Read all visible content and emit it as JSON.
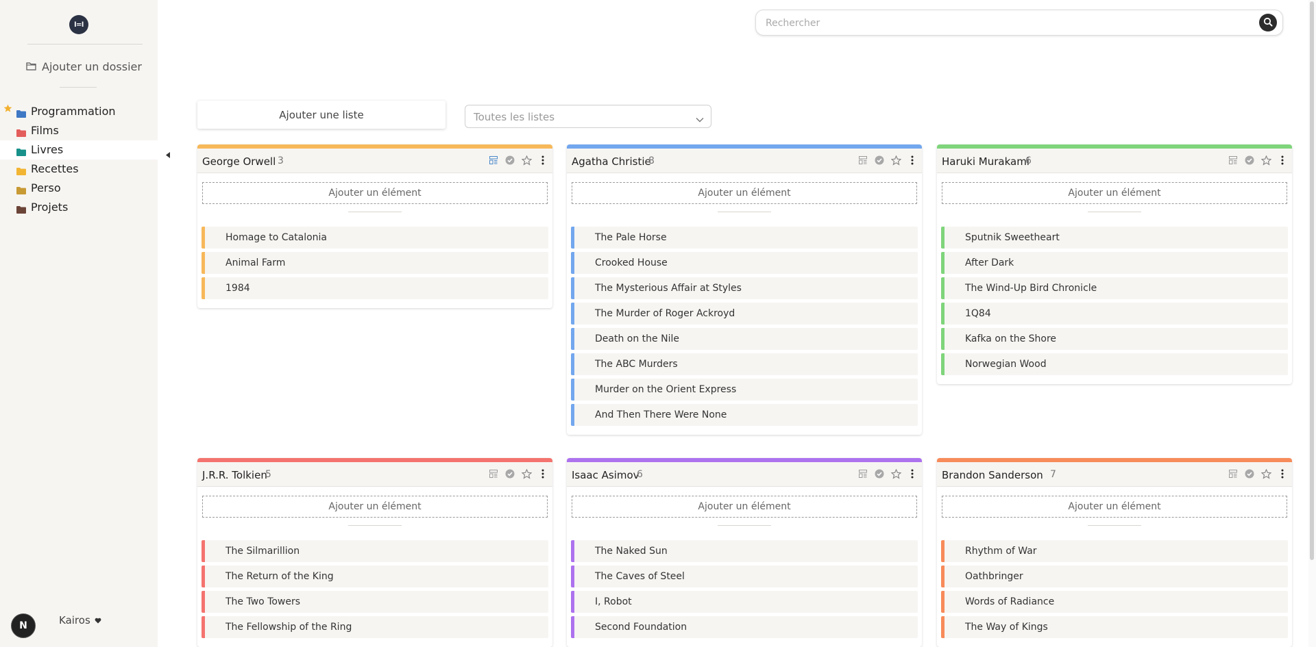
{
  "app": {
    "logo_text": "l=l"
  },
  "sidebar": {
    "add_folder_label": "Ajouter un dossier",
    "folders": [
      {
        "label": "Programmation",
        "color": "#3f78c4",
        "starred": true
      },
      {
        "label": "Films",
        "color": "#e35d5a",
        "starred": false
      },
      {
        "label": "Livres",
        "color": "#18918a",
        "starred": false,
        "active": true
      },
      {
        "label": "Recettes",
        "color": "#f2b533",
        "starred": false
      },
      {
        "label": "Perso",
        "color": "#c89a35",
        "starred": false
      },
      {
        "label": "Projets",
        "color": "#6b4438",
        "starred": false
      }
    ],
    "user_initial": "N",
    "user_name": "Kairos"
  },
  "search": {
    "placeholder": "Rechercher"
  },
  "toolbar": {
    "add_list_label": "Ajouter une liste",
    "filter_label": "Toutes les listes"
  },
  "add_item_label": "Ajouter un élément",
  "lists": [
    {
      "title": "George Orwell",
      "count": "3",
      "color": "#f7b85a",
      "items": [
        "Homage to Catalonia",
        "Animal Farm",
        "1984"
      ]
    },
    {
      "title": "Agatha Christie",
      "count": "8",
      "color": "#73a7ee",
      "items": [
        "The Pale Horse",
        "Crooked House",
        "The Mysterious Affair at Styles",
        "The Murder of Roger Ackroyd",
        "Death on the Nile",
        "The ABC Murders",
        "Murder on the Orient Express",
        "And Then There Were None"
      ]
    },
    {
      "title": "Haruki Murakami",
      "count": "6",
      "color": "#7fd57b",
      "items": [
        "Sputnik Sweetheart",
        "After Dark",
        "The Wind-Up Bird Chronicle",
        "1Q84",
        "Kafka on the Shore",
        "Norwegian Wood"
      ]
    },
    {
      "title": "J.R.R. Tolkien",
      "count": "5",
      "color": "#f4736e",
      "items": [
        "The Silmarillion",
        "The Return of the King",
        "The Two Towers",
        "The Fellowship of the Ring"
      ]
    },
    {
      "title": "Isaac Asimov",
      "count": "6",
      "color": "#ad72ee",
      "items": [
        "The Naked Sun",
        "The Caves of Steel",
        "I, Robot",
        "Second Foundation"
      ]
    },
    {
      "title": "Brandon Sanderson",
      "count": "7",
      "color": "#f78b5a",
      "items": [
        "Rhythm of War",
        "Oathbringer",
        "Words of Radiance",
        "The Way of Kings"
      ]
    }
  ]
}
